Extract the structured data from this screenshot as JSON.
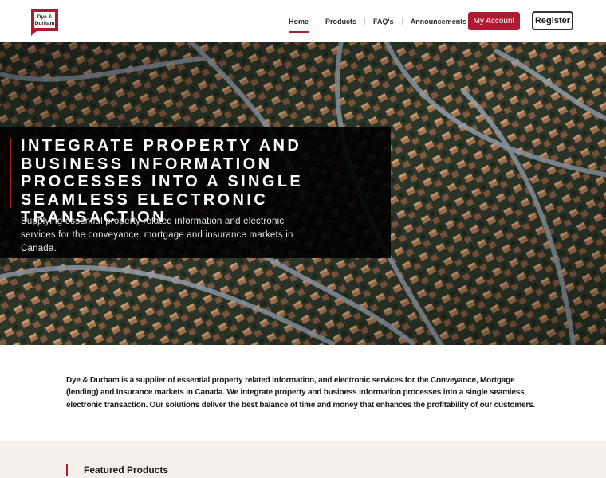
{
  "brand": {
    "logo_line1": "Dye &",
    "logo_line2": "Durham",
    "accent": "#b0192f"
  },
  "nav": {
    "items": [
      {
        "label": "Home",
        "active": true
      },
      {
        "label": "Products",
        "active": false
      },
      {
        "label": "FAQ's",
        "active": false
      },
      {
        "label": "Announcements",
        "active": false
      }
    ],
    "my_account": "My Account",
    "register": "Register"
  },
  "hero": {
    "title": "Integrate property and business information processes into a single seamless electronic transaction",
    "subtitle": "Supplying essential property related information and electronic services for the conveyance, mortgage and insurance markets in Canada."
  },
  "about": {
    "text": "Dye & Durham is a supplier of essential property related information, and electronic services for the Conveyance, Mortgage (lending) and Insurance markets in Canada. We integrate property and business information processes into a single seamless electronic transaction. Our solutions deliver the best balance of time and money that enhances the profitability of our customers."
  },
  "featured": {
    "title": "Featured Products"
  }
}
